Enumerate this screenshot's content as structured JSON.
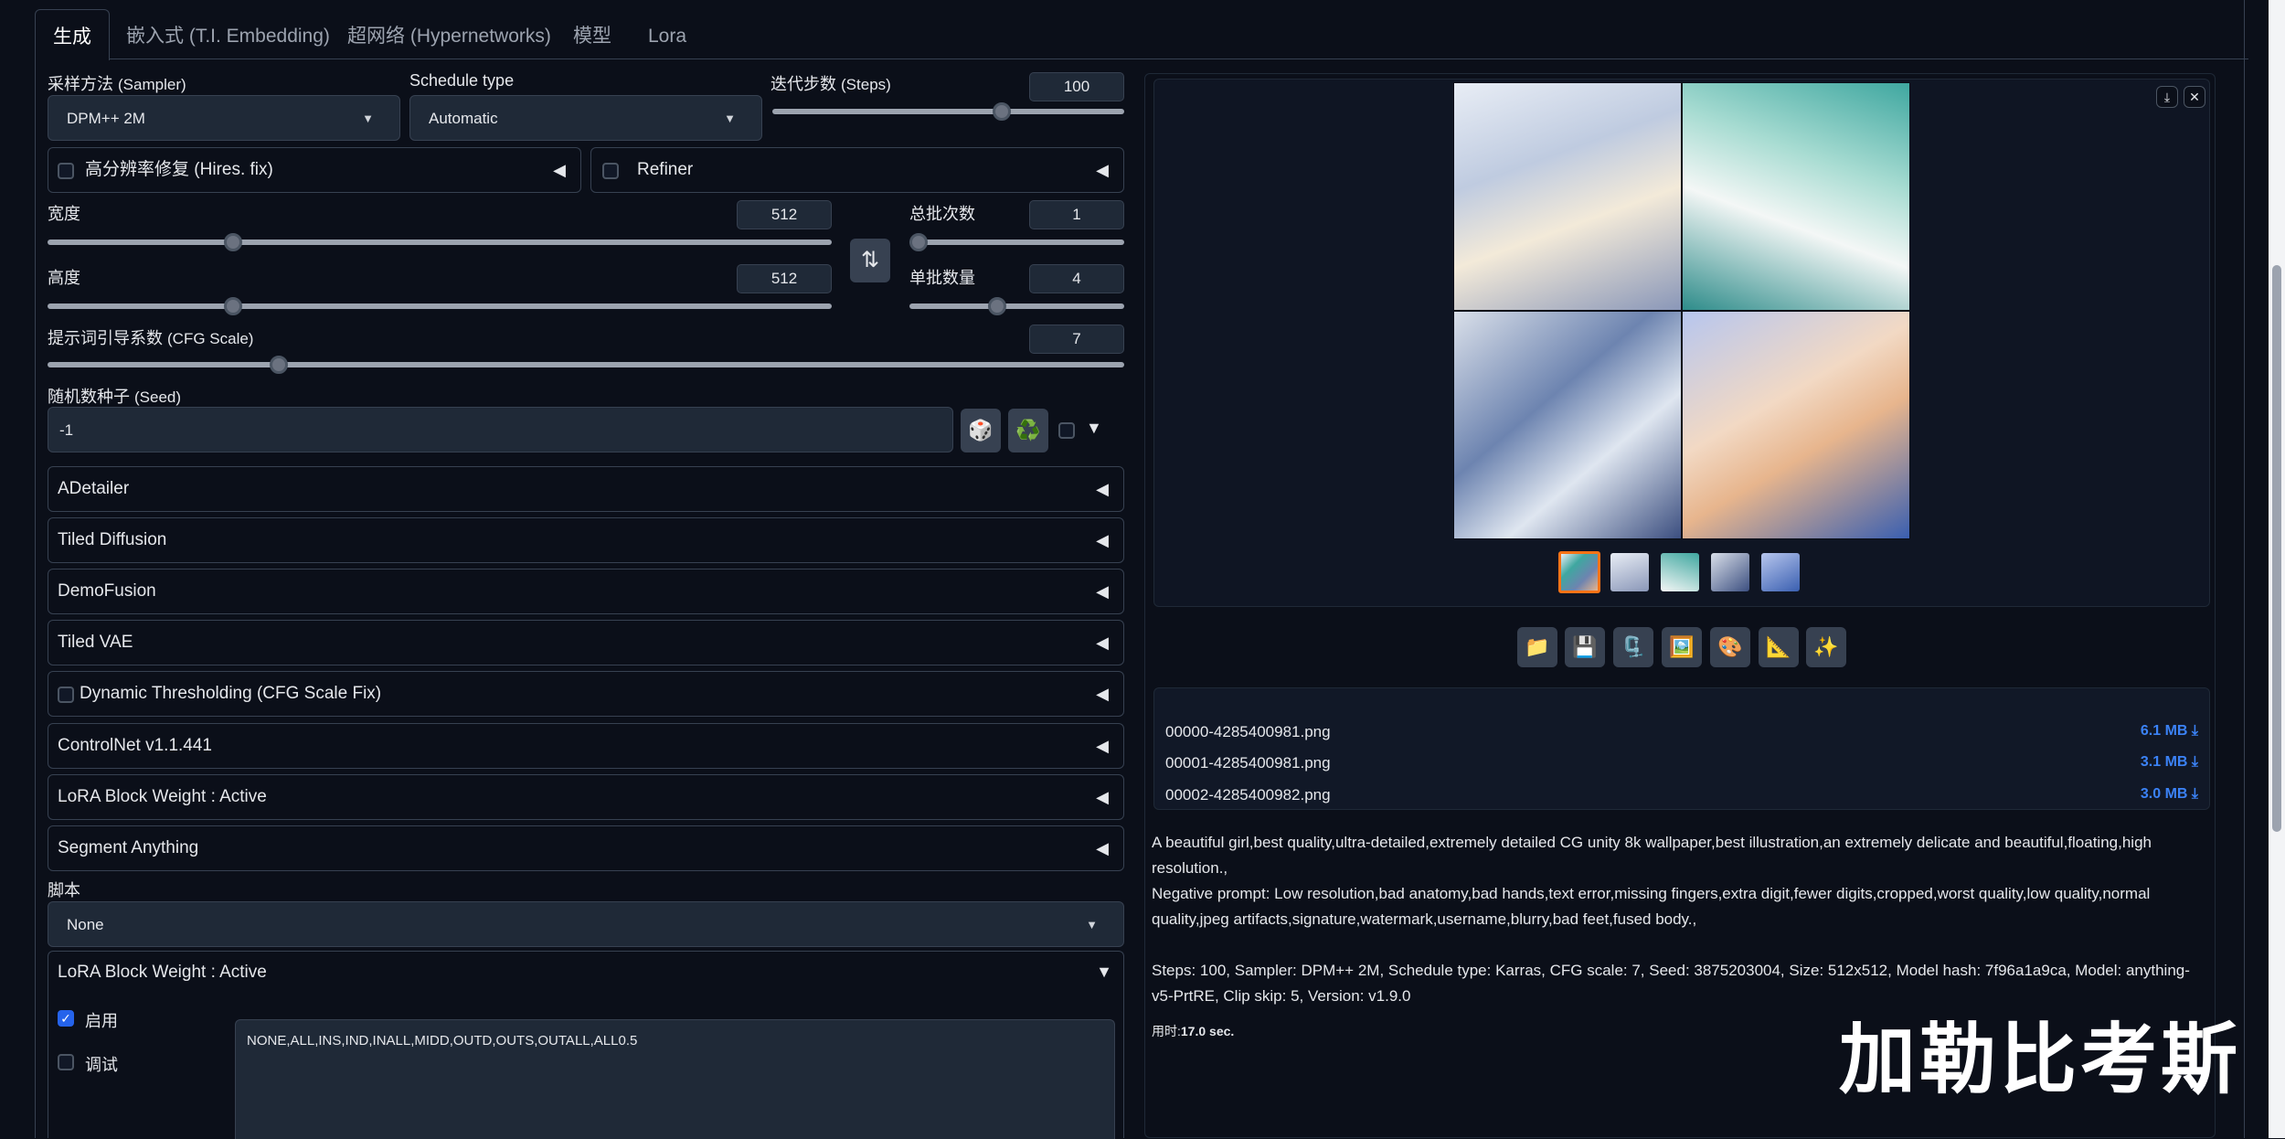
{
  "tabs": [
    "生成",
    "嵌入式 (T.I. Embedding)",
    "超网络 (Hypernetworks)",
    "模型",
    "Lora"
  ],
  "sampler": {
    "label_cn": "采样方法",
    "label_en": "(Sampler)",
    "value": "DPM++ 2M"
  },
  "schedule": {
    "label": "Schedule type",
    "value": "Automatic"
  },
  "steps": {
    "label_cn": "迭代步数",
    "label_en": "(Steps)",
    "value": "100",
    "fraction": 0.66
  },
  "hires": {
    "label_cn": "高分辨率修复",
    "label_en": "(Hires. fix)"
  },
  "refiner": {
    "label": "Refiner"
  },
  "width": {
    "label": "宽度",
    "value": "512",
    "fraction": 0.23
  },
  "height": {
    "label": "高度",
    "value": "512",
    "fraction": 0.23
  },
  "swap_icon": "⇅",
  "batch_count": {
    "label": "总批次数",
    "value": "1",
    "fraction": 0.0
  },
  "batch_size": {
    "label": "单批数量",
    "value": "4",
    "fraction": 0.4
  },
  "cfg": {
    "label_cn": "提示词引导系数",
    "label_en": "(CFG Scale)",
    "value": "7",
    "fraction": 0.21
  },
  "seed": {
    "label_cn": "随机数种子",
    "label_en": "(Seed)",
    "value": "-1"
  },
  "seed_icons": {
    "dice": "🎲",
    "recycle": "♻️"
  },
  "accordions": [
    "ADetailer",
    "Tiled Diffusion",
    "DemoFusion",
    "Tiled VAE",
    "Dynamic Thresholding (CFG Scale Fix)",
    "ControlNet v1.1.441",
    "LoRA Block Weight : Active",
    "Segment Anything"
  ],
  "script": {
    "label": "脚本",
    "value": "None"
  },
  "lbw_panel": {
    "title": "LoRA Block Weight : Active",
    "enable_label": "启用",
    "debug_label": "调试",
    "text": "NONE,ALL,INS,IND,INALL,MIDD,OUTD,OUTS,OUTALL,ALL0.5"
  },
  "gallery_controls": {
    "download": "⤓",
    "close": "✕"
  },
  "action_icons": [
    "📁",
    "💾",
    "🗜️",
    "🖼️",
    "🎨",
    "📐",
    "✨"
  ],
  "files": [
    {
      "name": "00000-4285400981.png",
      "size": "6.1 MB ⤓"
    },
    {
      "name": "00001-4285400981.png",
      "size": "3.1 MB ⤓"
    },
    {
      "name": "00002-4285400982.png",
      "size": "3.0 MB ⤓"
    }
  ],
  "info": {
    "prompt": "A beautiful girl,best quality,ultra-detailed,extremely detailed CG unity 8k wallpaper,best illustration,an extremely delicate and beautiful,floating,high resolution.,",
    "negative": "Negative prompt: Low resolution,bad anatomy,bad hands,text error,missing fingers,extra digit,fewer digits,cropped,worst quality,low quality,normal quality,jpeg artifacts,signature,watermark,username,blurry,bad feet,fused body.,",
    "params": "Steps: 100, Sampler: DPM++ 2M, Schedule type: Karras, CFG scale: 7, Seed: 3875203004, Size: 512x512, Model hash: 7f96a1a9ca, Model: anything-v5-PrtRE, Clip skip: 5, Version: v1.9.0",
    "time_label": "用时:",
    "time_value": "17.0 sec."
  },
  "watermark": "加勒比考斯",
  "colors": {
    "accent": "#2563eb",
    "orange": "#f97316",
    "background": "#0b0f19",
    "panel": "#1f2937"
  }
}
